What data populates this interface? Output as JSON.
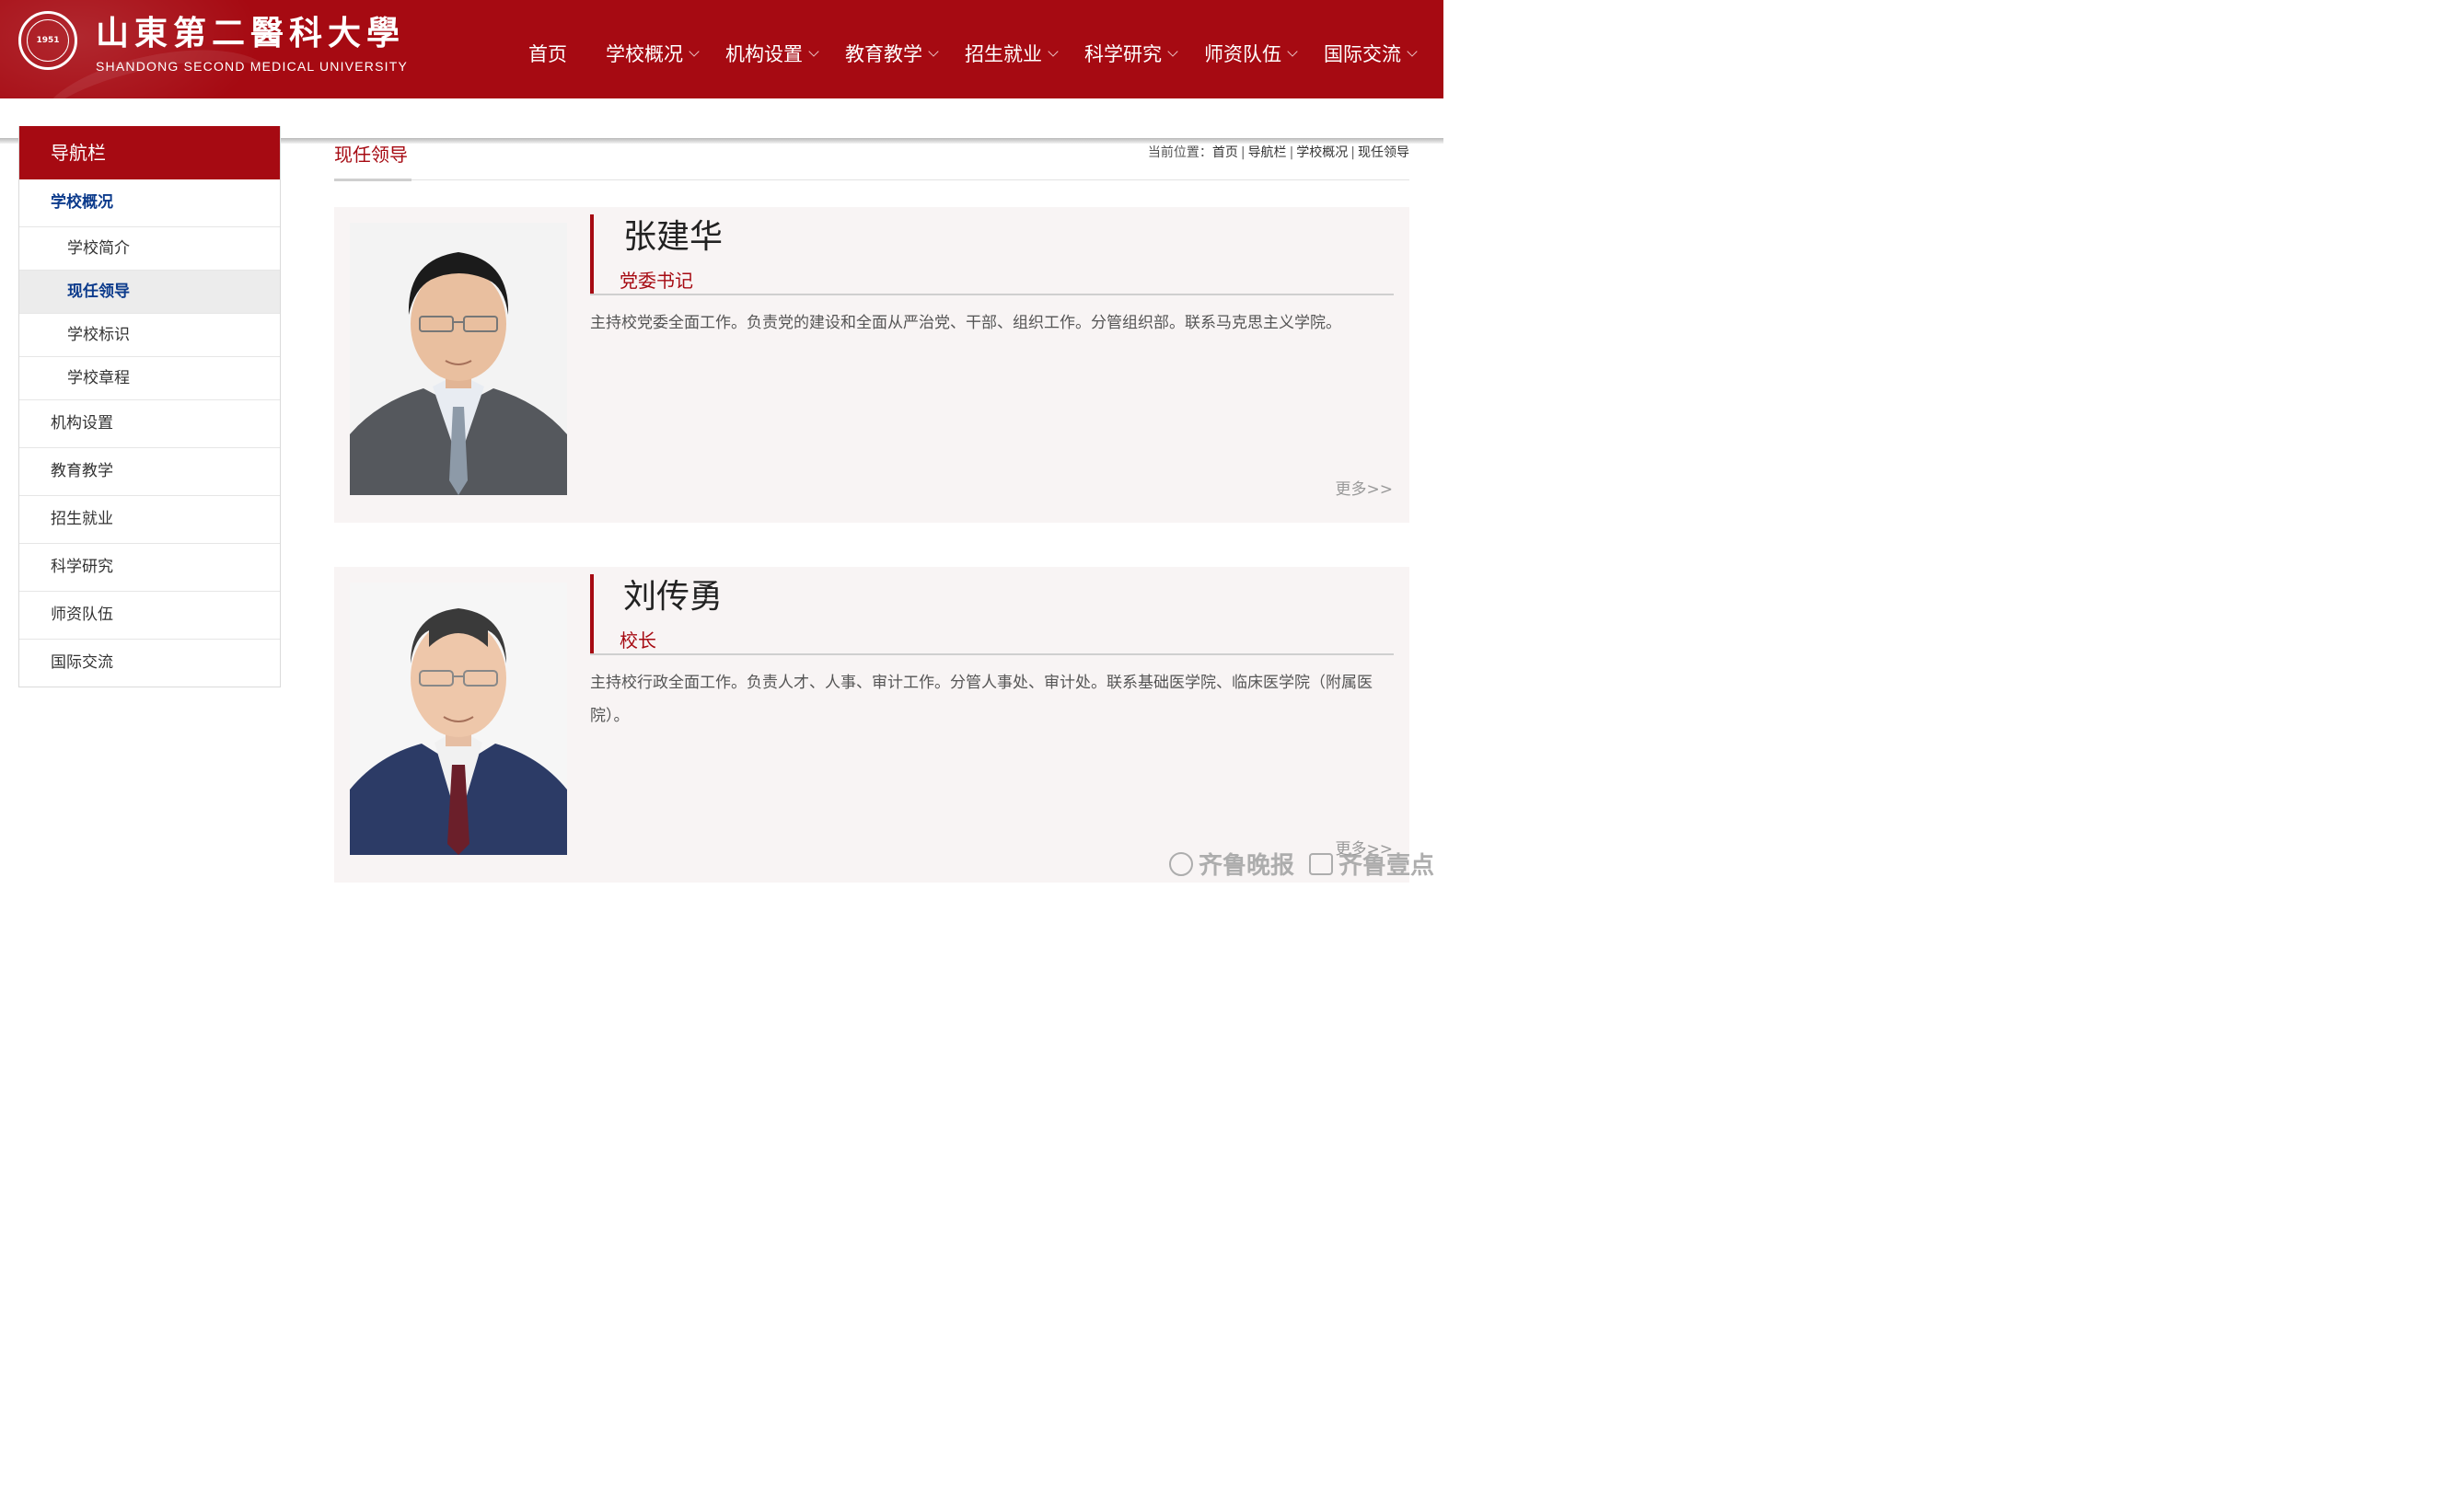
{
  "header": {
    "logo_cn": "山東第二醫科大學",
    "logo_en": "SHANDONG SECOND MEDICAL UNIVERSITY",
    "seal_year": "1951",
    "nav": [
      {
        "label": "首页",
        "dropdown": false
      },
      {
        "label": "学校概况",
        "dropdown": true
      },
      {
        "label": "机构设置",
        "dropdown": true
      },
      {
        "label": "教育教学",
        "dropdown": true
      },
      {
        "label": "招生就业",
        "dropdown": true
      },
      {
        "label": "科学研究",
        "dropdown": true
      },
      {
        "label": "师资队伍",
        "dropdown": true
      },
      {
        "label": "国际交流",
        "dropdown": true
      }
    ]
  },
  "sidebar": {
    "title": "导航栏",
    "active_section": "学校概况",
    "sub_items": [
      "学校简介",
      "现任领导",
      "学校标识",
      "学校章程"
    ],
    "current_sub": "现任领导",
    "sections": [
      "机构设置",
      "教育教学",
      "招生就业",
      "科学研究",
      "师资队伍",
      "国际交流"
    ]
  },
  "main": {
    "title": "现任领导",
    "breadcrumb": {
      "prefix": "当前位置：",
      "items": [
        "首页",
        "导航栏",
        "学校概况",
        "现任领导"
      ],
      "separator": "|"
    }
  },
  "leaders": [
    {
      "name": "张建华",
      "role": "党委书记",
      "description": "主持校党委全面工作。负责党的建设和全面从严治党、干部、组织工作。分管组织部。联系马克思主义学院。",
      "more": "更多>>"
    },
    {
      "name": "刘传勇",
      "role": "校长",
      "description": "主持校行政全面工作。负责人才、人事、审计工作。分管人事处、审计处。联系基础医学院、临床医学院（附属医院）。",
      "more": "更多>>"
    }
  ],
  "watermark": {
    "brand1": "齐鲁晚报",
    "brand2": "齐鲁壹点"
  },
  "colors": {
    "primary_red": "#a60a12",
    "active_blue": "#0c3b8c",
    "card_bg": "#f8f4f4"
  }
}
